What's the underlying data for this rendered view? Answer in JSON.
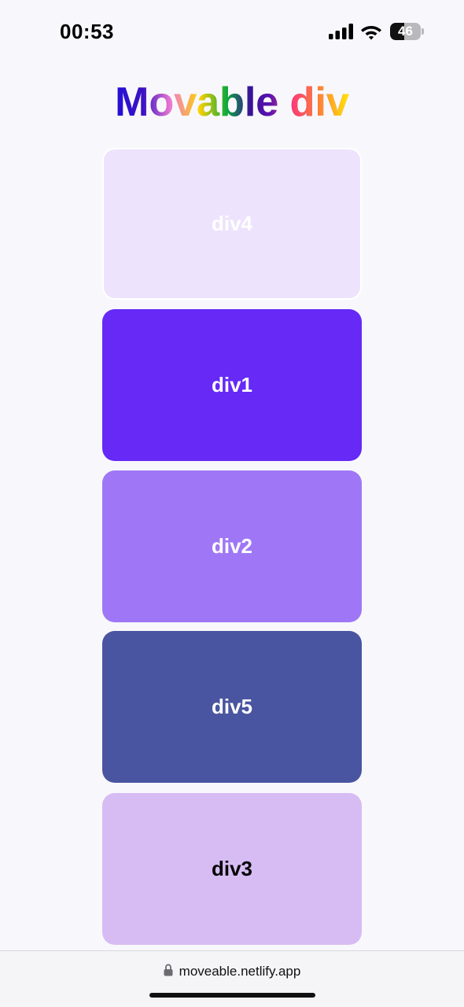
{
  "status_bar": {
    "time": "00:53",
    "signal_icon": "cellular-signal-icon",
    "wifi_icon": "wifi-icon",
    "battery_icon": "battery-icon",
    "battery_level": "46",
    "battery_fraction": 0.46
  },
  "page": {
    "title": "Movable div"
  },
  "divs": [
    {
      "label": "div4",
      "color": "#ede3fd",
      "text_color": "#ffffff"
    },
    {
      "label": "div1",
      "color": "#6629f6",
      "text_color": "#ffffff"
    },
    {
      "label": "div2",
      "color": "#9f77f6",
      "text_color": "#ffffff"
    },
    {
      "label": "div5",
      "color": "#4955a0",
      "text_color": "#ffffff"
    },
    {
      "label": "div3",
      "color": "#d7bcf4",
      "text_color": "#000000"
    }
  ],
  "browser": {
    "lock_icon": "lock-icon",
    "url": "moveable.netlify.app"
  }
}
